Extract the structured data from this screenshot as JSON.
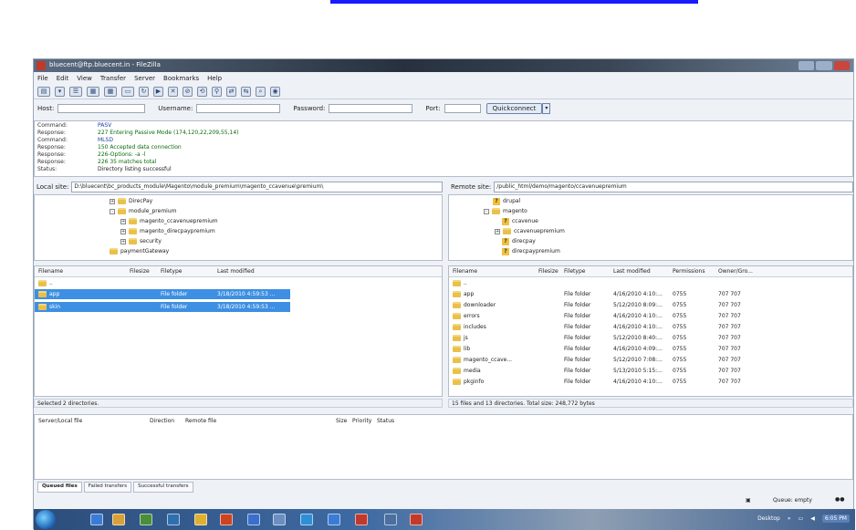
{
  "window": {
    "title": "bluecent@ftp.bluecent.in - FileZilla"
  },
  "menu": [
    "File",
    "Edit",
    "View",
    "Transfer",
    "Server",
    "Bookmarks",
    "Help"
  ],
  "toolbar_icons": [
    "site-manager-icon",
    "dropdown-icon",
    "toggle-log-icon",
    "toggle-local-tree-icon",
    "toggle-remote-tree-icon",
    "toggle-queue-icon",
    "refresh-icon",
    "process-queue-icon",
    "cancel-icon",
    "disconnect-icon",
    "reconnect-icon",
    "filter-icon",
    "compare-icon",
    "sync-browse-icon",
    "search-icon",
    "find-icon"
  ],
  "quickconnect": {
    "host_label": "Host:",
    "username_label": "Username:",
    "password_label": "Password:",
    "port_label": "Port:",
    "button_label": "Quickconnect"
  },
  "log": [
    {
      "key": "Command:",
      "value": "PASV",
      "color": "blue"
    },
    {
      "key": "Response:",
      "value": "227 Entering Passive Mode (174,120,22,209,55,14)",
      "color": "green"
    },
    {
      "key": "Command:",
      "value": "MLSD",
      "color": "blue"
    },
    {
      "key": "Response:",
      "value": "150 Accepted data connection",
      "color": "green"
    },
    {
      "key": "Response:",
      "value": "226-Options: -a -l",
      "color": "green"
    },
    {
      "key": "Response:",
      "value": "226 35 matches total",
      "color": "green"
    },
    {
      "key": "Status:",
      "value": "Directory listing successful",
      "color": "black"
    }
  ],
  "local": {
    "site_label": "Local site:",
    "path": "D:\\bluecent\\bc_products_module\\Magento\\module_premium\\magento_ccavenue\\premium\\",
    "tree": [
      {
        "label": "DirecPay",
        "indent": 1,
        "expander": "+"
      },
      {
        "label": "module_premium",
        "indent": 1,
        "expander": "-"
      },
      {
        "label": "magento_ccavenuepremium",
        "indent": 2,
        "expander": "+"
      },
      {
        "label": "magento_direcpaypremium",
        "indent": 2,
        "expander": "+"
      },
      {
        "label": "security",
        "indent": 2,
        "expander": "+"
      },
      {
        "label": "paymentGateway",
        "indent": 1,
        "expander": ""
      }
    ],
    "columns": [
      "Filename",
      "Filesize",
      "Filetype",
      "Last modified"
    ],
    "rows": [
      {
        "name": "..",
        "type": "",
        "modified": "",
        "selected": false
      },
      {
        "name": "app",
        "type": "File folder",
        "modified": "3/18/2010 4:59:53 ...",
        "selected": true
      },
      {
        "name": "skin",
        "type": "File folder",
        "modified": "3/18/2010 4:59:53 ...",
        "selected": true
      }
    ],
    "status": "Selected 2 directories."
  },
  "remote": {
    "site_label": "Remote site:",
    "path": "/public_html/demo/magento/ccavenuepremium",
    "tree": [
      {
        "label": "drupal",
        "indent": 1,
        "icon": "question",
        "expander": ""
      },
      {
        "label": "magento",
        "indent": 1,
        "icon": "folder",
        "expander": "-"
      },
      {
        "label": "ccavenue",
        "indent": 2,
        "icon": "question",
        "expander": ""
      },
      {
        "label": "ccavenuepremium",
        "indent": 2,
        "icon": "folder",
        "expander": "+"
      },
      {
        "label": "direcpay",
        "indent": 2,
        "icon": "question",
        "expander": ""
      },
      {
        "label": "direcpaypremium",
        "indent": 2,
        "icon": "question",
        "expander": ""
      }
    ],
    "columns": [
      "Filename",
      "Filesize",
      "Filetype",
      "Last modified",
      "Permissions",
      "Owner/Gro..."
    ],
    "rows": [
      {
        "name": "..",
        "type": "",
        "modified": "",
        "perm": "",
        "owner": ""
      },
      {
        "name": "app",
        "type": "File folder",
        "modified": "4/16/2010 4:10:...",
        "perm": "0755",
        "owner": "707 707"
      },
      {
        "name": "downloader",
        "type": "File folder",
        "modified": "5/12/2010 8:09:...",
        "perm": "0755",
        "owner": "707 707"
      },
      {
        "name": "errors",
        "type": "File folder",
        "modified": "4/16/2010 4:10:...",
        "perm": "0755",
        "owner": "707 707"
      },
      {
        "name": "includes",
        "type": "File folder",
        "modified": "4/16/2010 4:10:...",
        "perm": "0755",
        "owner": "707 707"
      },
      {
        "name": "js",
        "type": "File folder",
        "modified": "5/12/2010 8:40:...",
        "perm": "0755",
        "owner": "707 707"
      },
      {
        "name": "lib",
        "type": "File folder",
        "modified": "4/16/2010 4:09:...",
        "perm": "0755",
        "owner": "707 707"
      },
      {
        "name": "magento_ccave...",
        "type": "File folder",
        "modified": "5/12/2010 7:08:...",
        "perm": "0755",
        "owner": "707 707"
      },
      {
        "name": "media",
        "type": "File folder",
        "modified": "5/13/2010 5:15:...",
        "perm": "0755",
        "owner": "707 707"
      },
      {
        "name": "pkginfo",
        "type": "File folder",
        "modified": "4/16/2010 4:10:...",
        "perm": "0755",
        "owner": "707 707"
      }
    ],
    "status": "15 files and 13 directories. Total size: 248,772 bytes"
  },
  "queue": {
    "columns": [
      "Server/Local file",
      "Direction",
      "Remote file",
      "Size",
      "Priority",
      "Status"
    ],
    "tabs": [
      "Queued files",
      "Failed transfers",
      "Successful transfers"
    ],
    "status": "Queue: empty"
  },
  "taskbar": {
    "desktop_label": "Desktop",
    "clock": "6:05 PM",
    "colors": [
      "#3a7bd5",
      "#d9a03a",
      "#4a8f3a",
      "#2f6fb0",
      "#e0b030",
      "#cc4422",
      "#3a6fcc",
      "#6a8fc0",
      "#2d8fd6",
      "#3a7bd5",
      "#c0392b",
      "#4a6fa0",
      "#c23a2a"
    ]
  }
}
